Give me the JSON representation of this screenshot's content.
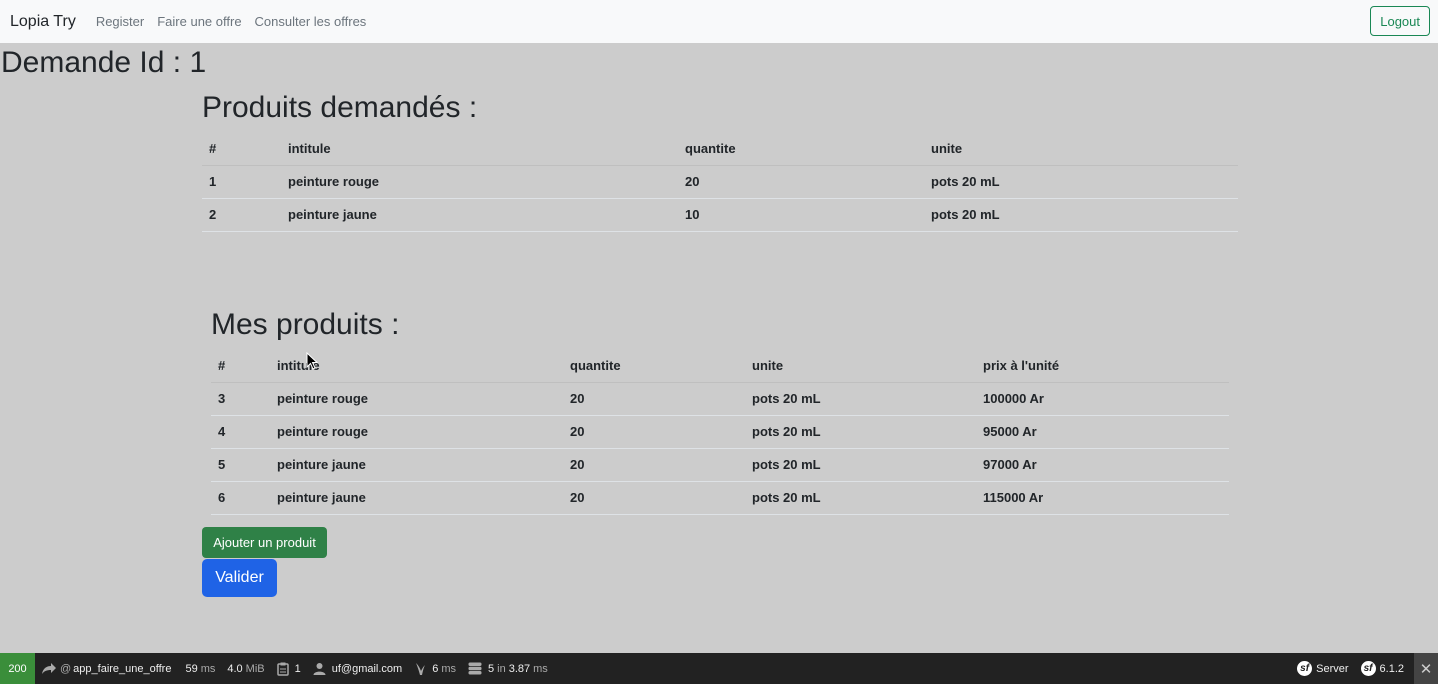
{
  "navbar": {
    "brand": "Lopia Try",
    "links": [
      "Register",
      "Faire une offre",
      "Consulter les offres"
    ],
    "logout": "Logout"
  },
  "page_title": "Demande Id : 1",
  "requested": {
    "title": "Produits demandés :",
    "headers": [
      "#",
      "intitule",
      "quantite",
      "unite"
    ],
    "rows": [
      [
        "1",
        "peinture rouge",
        "20",
        "pots 20 mL"
      ],
      [
        "2",
        "peinture jaune",
        "10",
        "pots 20 mL"
      ]
    ]
  },
  "mine": {
    "title": "Mes produits :",
    "headers": [
      "#",
      "intitule",
      "quantite",
      "unite",
      "prix à l'unité"
    ],
    "rows": [
      [
        "3",
        "peinture rouge",
        "20",
        "pots 20 mL",
        "100000 Ar"
      ],
      [
        "4",
        "peinture rouge",
        "20",
        "pots 20 mL",
        "95000 Ar"
      ],
      [
        "5",
        "peinture jaune",
        "20",
        "pots 20 mL",
        "97000 Ar"
      ],
      [
        "6",
        "peinture jaune",
        "20",
        "pots 20 mL",
        "115000 Ar"
      ]
    ]
  },
  "buttons": {
    "add": "Ajouter un produit",
    "validate": "Valider"
  },
  "toolbar": {
    "status": "200",
    "route": "app_faire_une_offre",
    "route_prefix": "@",
    "time": "59",
    "time_unit": "ms",
    "memory": "4.0",
    "memory_unit": "MiB",
    "logs": "1",
    "user": "uf@gmail.com",
    "twig_time": "6",
    "twig_unit": "ms",
    "db_queries": "5",
    "db_in": "in",
    "db_time": "3.87",
    "db_unit": "ms",
    "server": "Server",
    "version": "6.1.2"
  },
  "colors": {
    "background": "#cccccc",
    "success": "#198754",
    "primary": "#1f63e6"
  }
}
